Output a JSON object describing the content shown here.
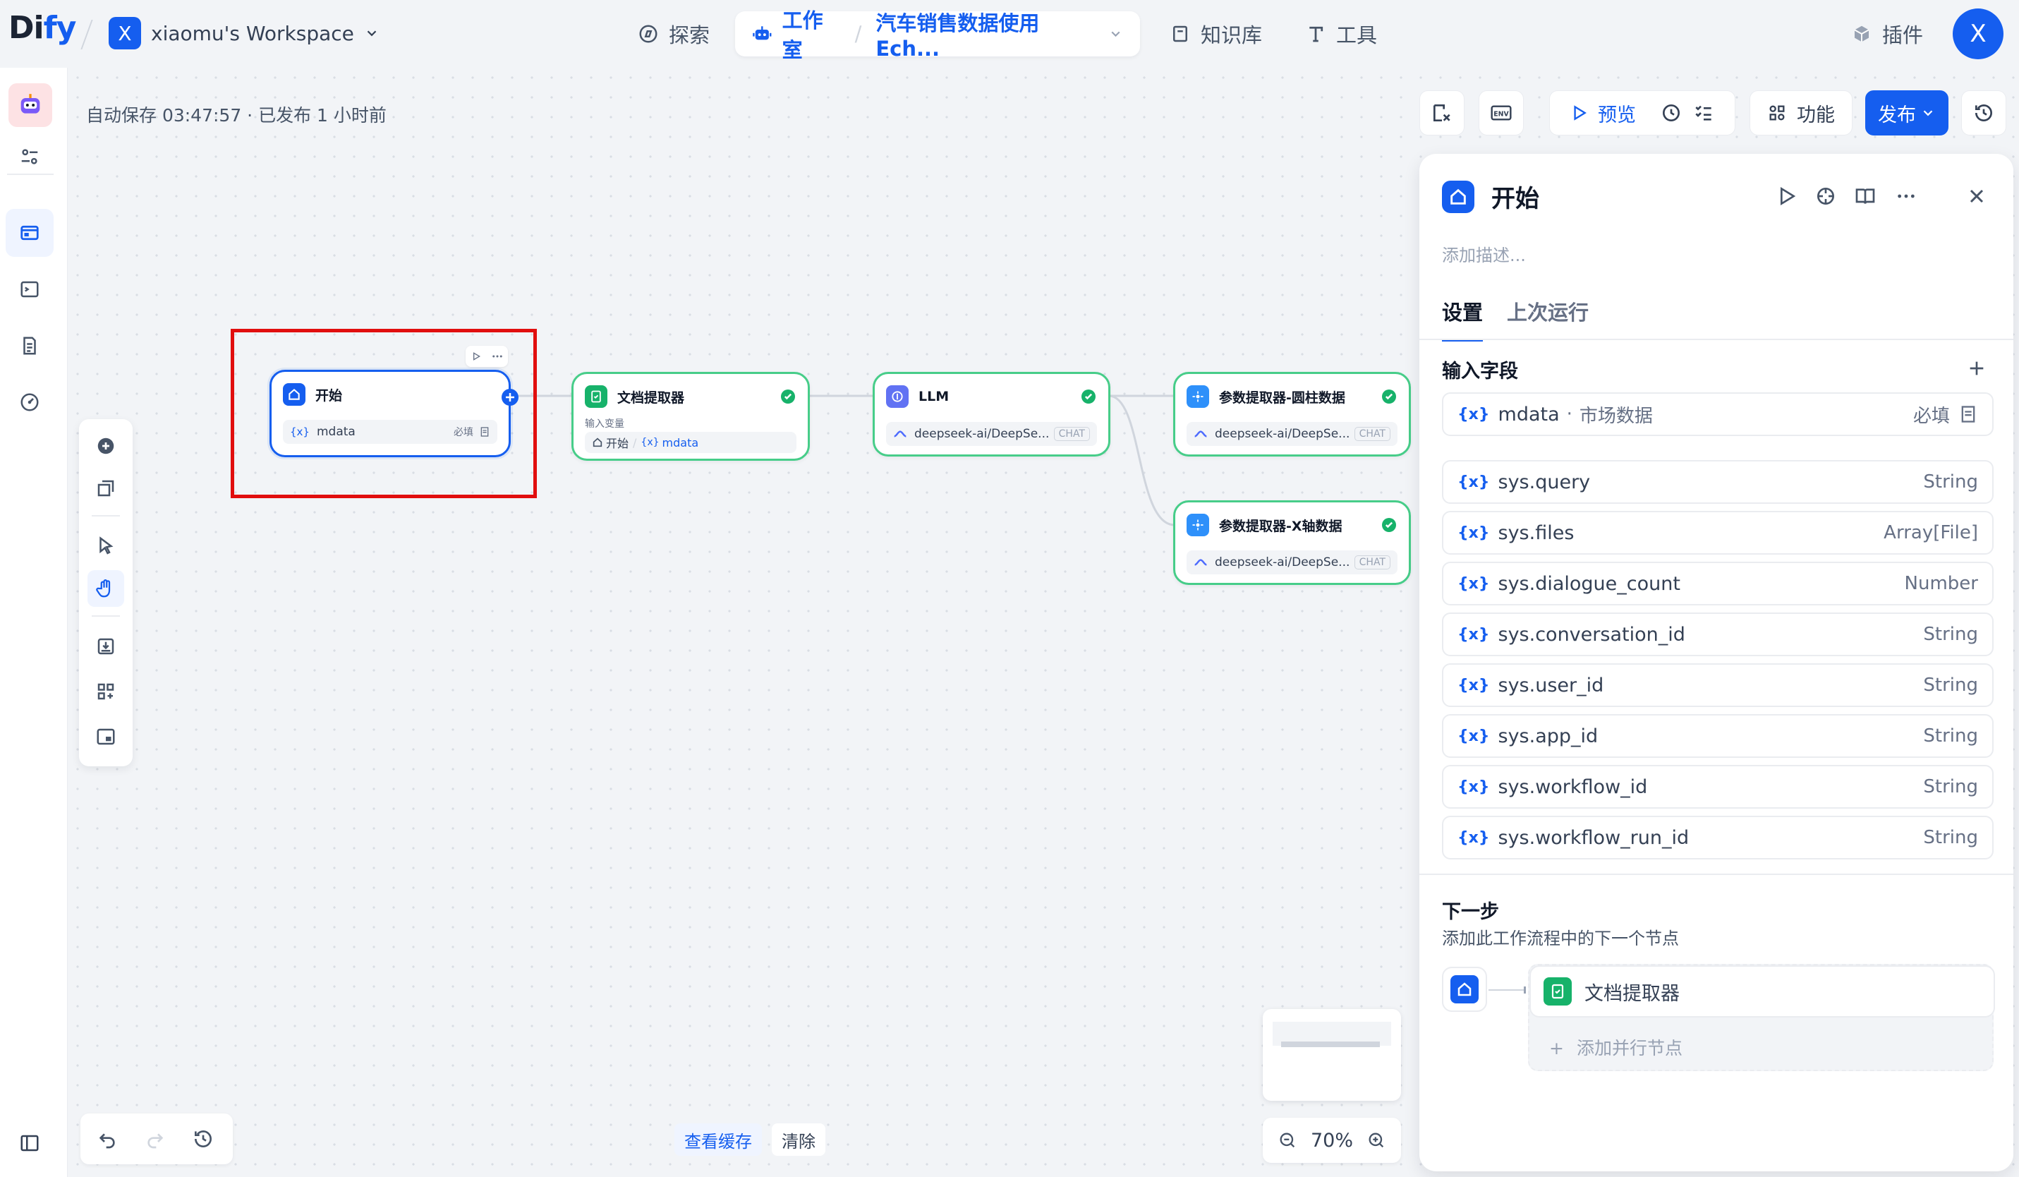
{
  "header": {
    "logo_main": "Di",
    "logo_accent": "fy",
    "workspace_badge": "X",
    "workspace_name": "xiaomu's Workspace",
    "nav": {
      "explore": "探索",
      "studio": "工作室",
      "app_name": "汽车销售数据使用Ech...",
      "knowledge": "知识库",
      "tools": "工具",
      "plugins": "插件"
    },
    "avatar_initial": "X"
  },
  "canvas": {
    "autosave": "自动保存 03:47:57 · 已发布 1 小时前",
    "view_cache": "查看缓存",
    "clear": "清除",
    "zoom": "70%",
    "nodes": {
      "start": {
        "title": "开始",
        "var": "mdata",
        "required": "必填"
      },
      "doc_extractor": {
        "title": "文档提取器",
        "input_label": "输入变量",
        "source_node": "开始",
        "source_var": "mdata"
      },
      "llm": {
        "title": "LLM",
        "model": "deepseek-ai/DeepSe...",
        "mode": "CHAT"
      },
      "param_bar": {
        "title": "参数提取器-圆柱数据",
        "model": "deepseek-ai/DeepSe...",
        "mode": "CHAT"
      },
      "param_x": {
        "title": "参数提取器-X轴数据",
        "model": "deepseek-ai/DeepSe...",
        "mode": "CHAT"
      }
    }
  },
  "toolbar": {
    "preview": "预览",
    "features": "功能",
    "publish": "发布"
  },
  "panel": {
    "title": "开始",
    "description_placeholder": "添加描述...",
    "tabs": {
      "settings": "设置",
      "last_run": "上次运行"
    },
    "input_fields_title": "输入字段",
    "user_fields": [
      {
        "name": "mdata",
        "label": "市场数据",
        "type": "必填"
      }
    ],
    "system_fields": [
      {
        "name": "sys.query",
        "type": "String"
      },
      {
        "name": "sys.files",
        "type": "Array[File]"
      },
      {
        "name": "sys.dialogue_count",
        "type": "Number"
      },
      {
        "name": "sys.conversation_id",
        "type": "String"
      },
      {
        "name": "sys.user_id",
        "type": "String"
      },
      {
        "name": "sys.app_id",
        "type": "String"
      },
      {
        "name": "sys.workflow_id",
        "type": "String"
      },
      {
        "name": "sys.workflow_run_id",
        "type": "String"
      }
    ],
    "var_badge": "{x}",
    "next_step_title": "下一步",
    "next_step_sub": "添加此工作流程中的下一个节点",
    "next_node": "文档提取器",
    "add_parallel": "添加并行节点"
  },
  "colors": {
    "accent": "#155eef",
    "success": "#17b26a",
    "llm": "#6172f3",
    "highlight_box": "#e10e0e"
  }
}
